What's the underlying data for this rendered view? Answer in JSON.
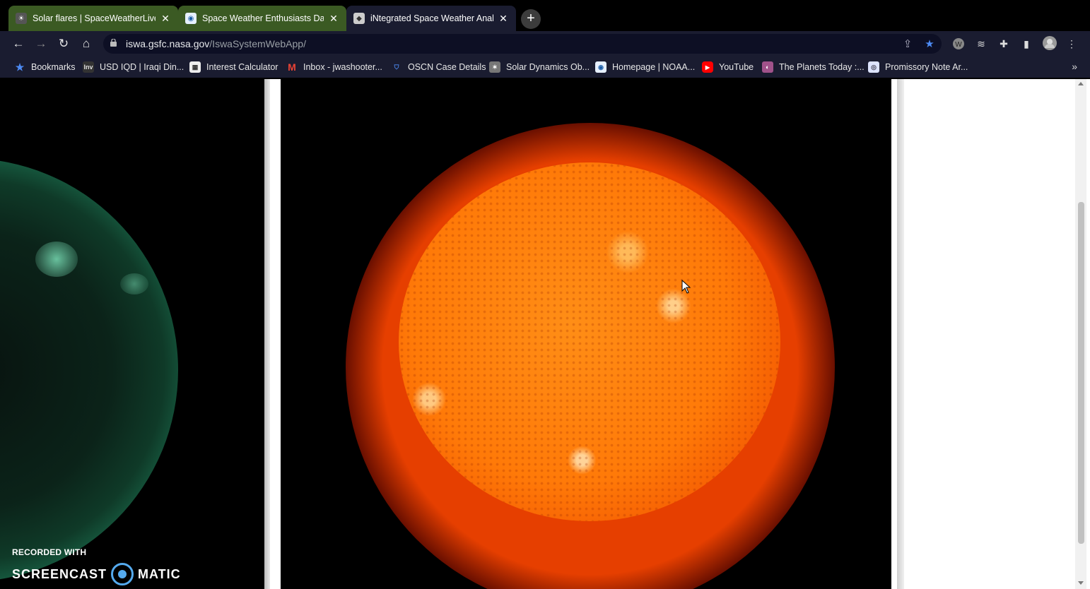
{
  "tabs": [
    {
      "title": "Solar flares | SpaceWeatherLive.c"
    },
    {
      "title": "Space Weather Enthusiasts Dash"
    },
    {
      "title": "iNtegrated Space Weather Analy"
    }
  ],
  "toolbar": {
    "url_host": "iswa.gsfc.nasa.gov",
    "url_path": "/IswaSystemWebApp/"
  },
  "bookmarks": [
    {
      "label": "Bookmarks",
      "icon": "star-icon"
    },
    {
      "label": "USD IQD | Iraqi Din...",
      "icon": "inv-icon"
    },
    {
      "label": "Interest Calculator",
      "icon": "calculator-icon"
    },
    {
      "label": "Inbox - jwashooter...",
      "icon": "gmail-icon"
    },
    {
      "label": "OSCN Case Details",
      "icon": "shield-icon"
    },
    {
      "label": "Solar Dynamics Ob...",
      "icon": "satellite-icon"
    },
    {
      "label": "Homepage | NOAA...",
      "icon": "noaa-icon"
    },
    {
      "label": "YouTube",
      "icon": "youtube-icon"
    },
    {
      "label": "The Planets Today :...",
      "icon": "planets-icon"
    },
    {
      "label": "Promissory Note Ar...",
      "icon": "globe-icon"
    }
  ],
  "watermark": {
    "line1": "RECORDED WITH",
    "brand_left": "SCREENCAST",
    "brand_right": "MATIC"
  },
  "colors": {
    "tab_active_group": "#3b5a23",
    "toolbar_bg": "#1a1c30",
    "star_accent": "#4d8bf5"
  }
}
